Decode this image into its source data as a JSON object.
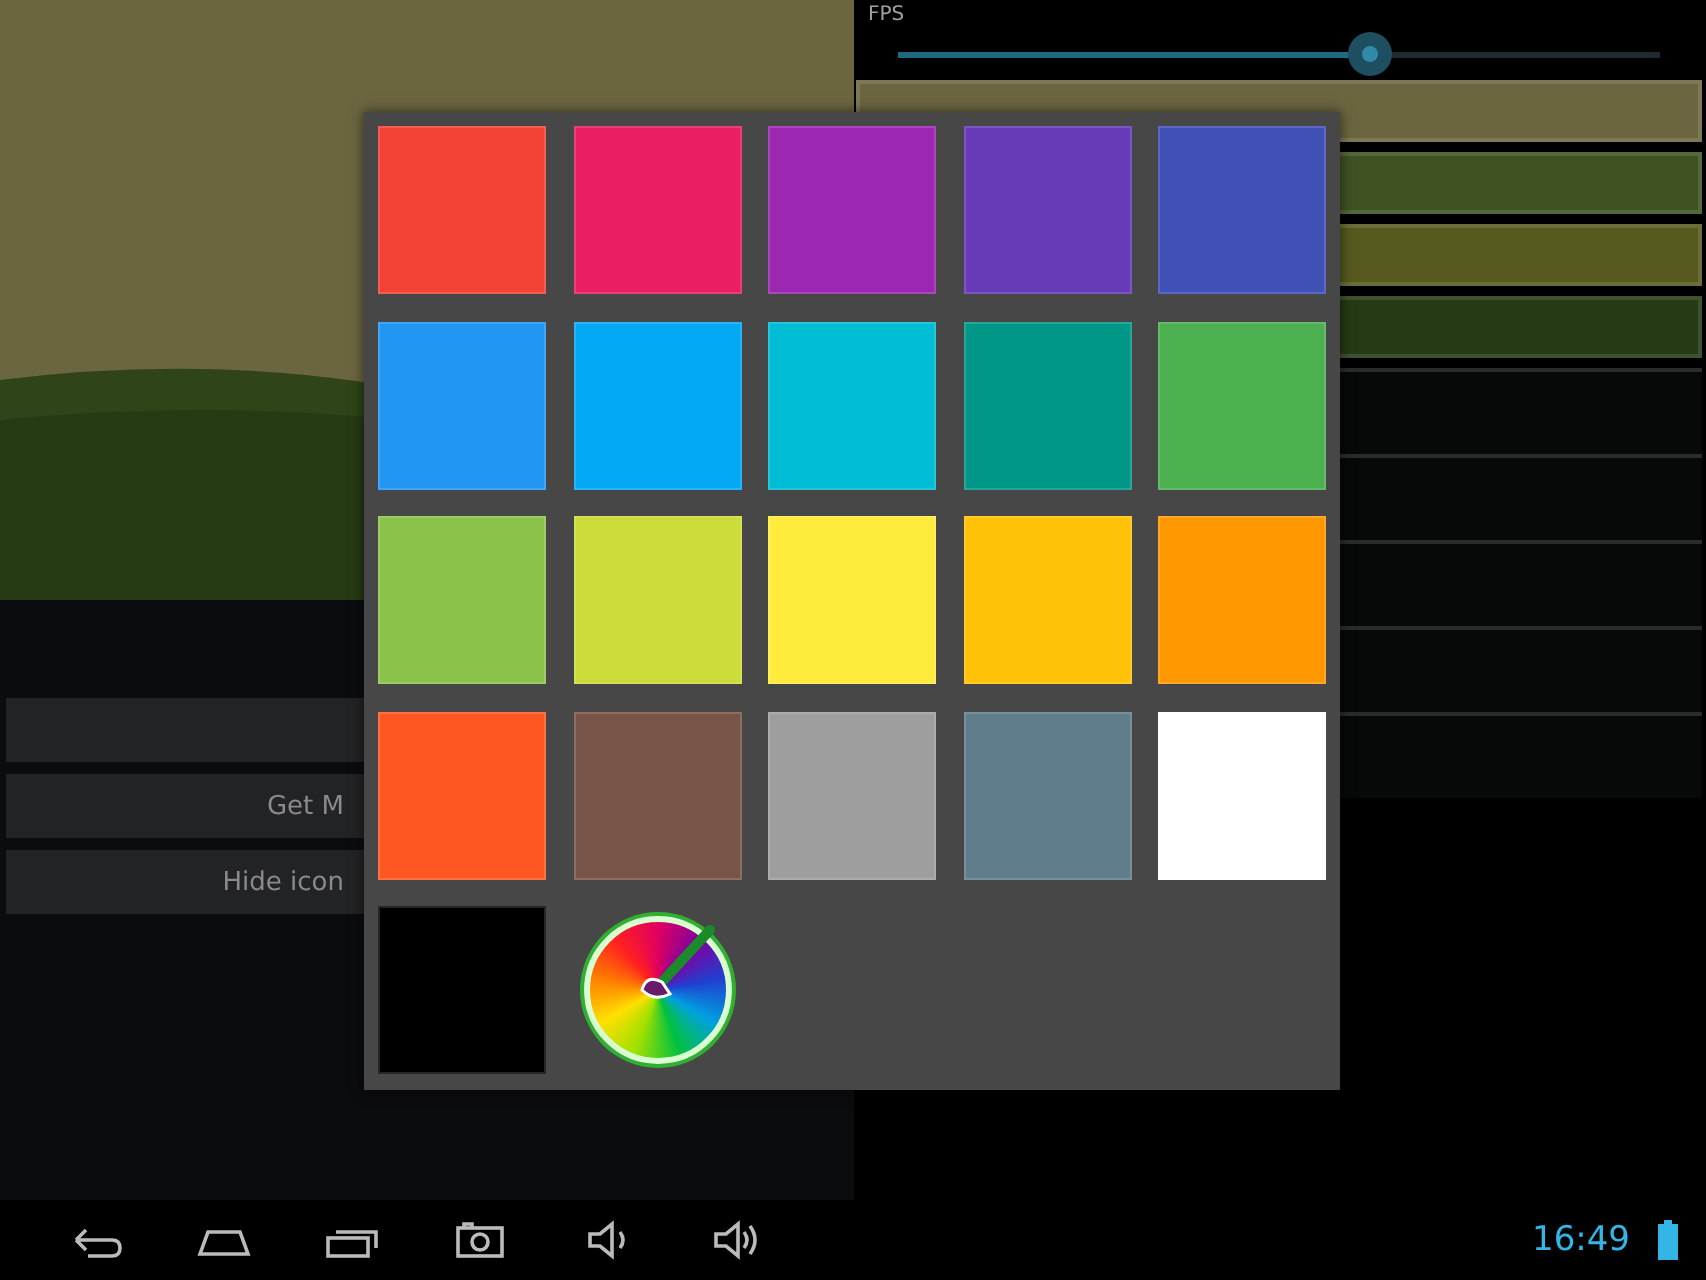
{
  "left_buttons": [
    {
      "label": "Get M"
    },
    {
      "label": "Hide icon"
    }
  ],
  "settings": {
    "fps": {
      "label": "FPS",
      "level": 0.62
    },
    "color_buttons": [
      {
        "color": "#6b6640"
      },
      {
        "color": "#3e5222"
      },
      {
        "color": "#565a1e"
      },
      {
        "color": "#263a16"
      }
    ]
  },
  "color_dialog": {
    "swatches": [
      {
        "color": "#f44336"
      },
      {
        "color": "#e91e63"
      },
      {
        "color": "#9c27b0"
      },
      {
        "color": "#673ab7"
      },
      {
        "color": "#3f51b5"
      },
      {
        "color": "#2196f3"
      },
      {
        "color": "#03a9f4"
      },
      {
        "color": "#00bcd4"
      },
      {
        "color": "#009688"
      },
      {
        "color": "#4caf50"
      },
      {
        "color": "#8bc34a"
      },
      {
        "color": "#cddc39"
      },
      {
        "color": "#ffeb3b"
      },
      {
        "color": "#ffc107"
      },
      {
        "color": "#ff9800"
      },
      {
        "color": "#ff5722"
      },
      {
        "color": "#795548"
      },
      {
        "color": "#9e9e9e"
      },
      {
        "color": "#607d8b"
      },
      {
        "color": "#ffffff"
      },
      {
        "color": "#000000"
      }
    ]
  },
  "status_bar": {
    "time": "16:49"
  }
}
